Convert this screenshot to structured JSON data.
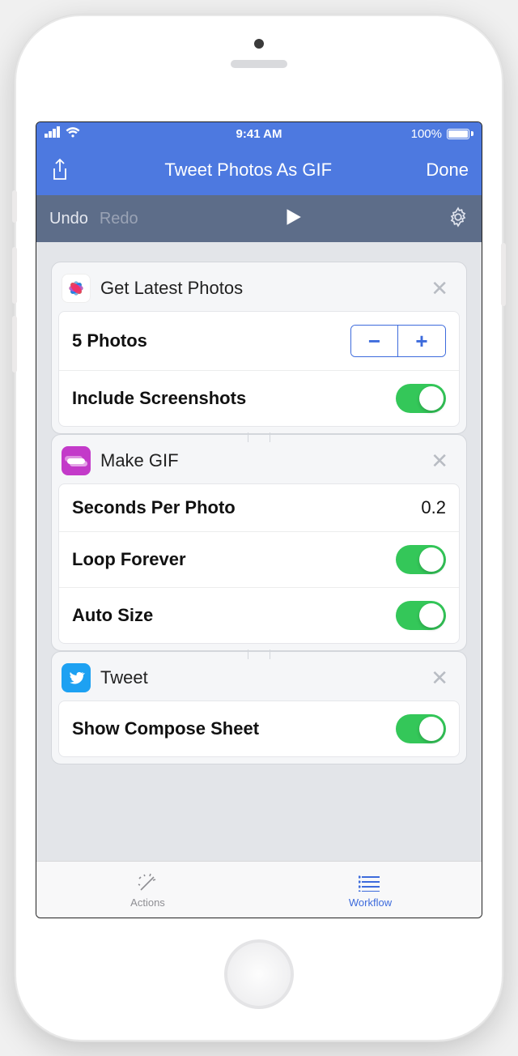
{
  "status": {
    "time": "9:41 AM",
    "battery_text": "100%"
  },
  "nav": {
    "title": "Tweet Photos As GIF",
    "done": "Done"
  },
  "tools": {
    "undo": "Undo",
    "redo": "Redo"
  },
  "actions": [
    {
      "title": "Get Latest Photos",
      "photo_count_label": "5 Photos",
      "screenshots_label": "Include Screenshots",
      "screenshots_on": true
    },
    {
      "title": "Make GIF",
      "seconds_label": "Seconds Per Photo",
      "seconds_value": "0.2",
      "loop_label": "Loop Forever",
      "loop_on": true,
      "autosize_label": "Auto Size",
      "autosize_on": true
    },
    {
      "title": "Tweet",
      "compose_label": "Show Compose Sheet",
      "compose_on": true
    }
  ],
  "tabs": {
    "actions": "Actions",
    "workflow": "Workflow"
  }
}
